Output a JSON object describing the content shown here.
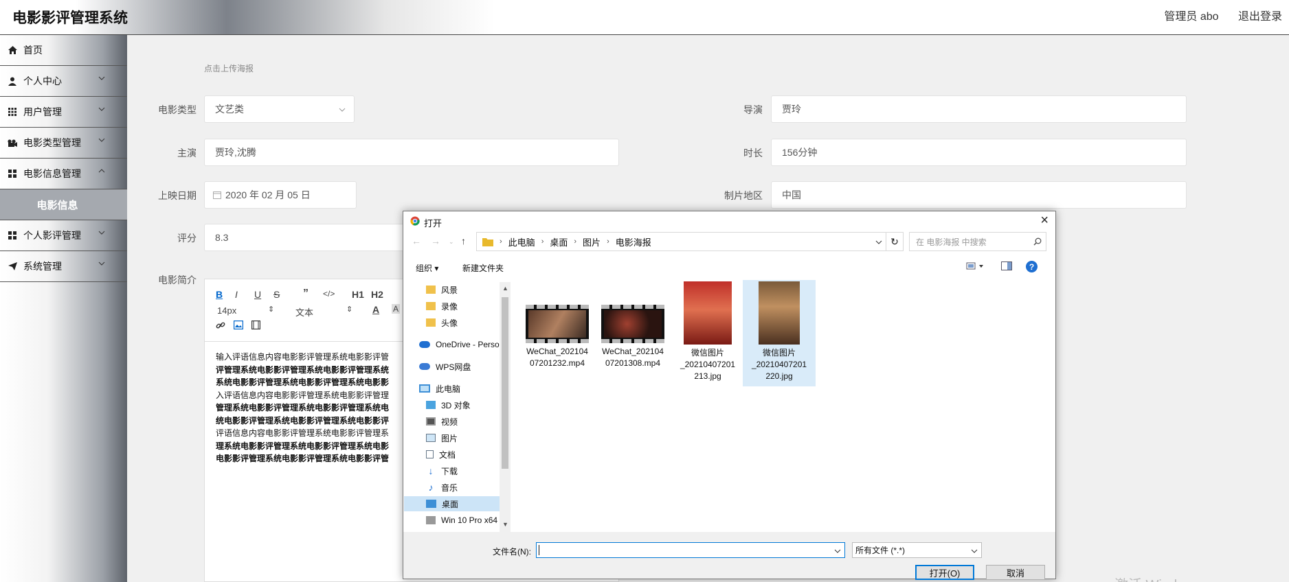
{
  "app": {
    "title": "电影影评管理系统"
  },
  "header": {
    "user": "管理员 abo",
    "logout": "退出登录"
  },
  "sidebar": {
    "items": [
      {
        "label": "首页",
        "icon": "home-icon"
      },
      {
        "label": "个人中心",
        "icon": "user-icon"
      },
      {
        "label": "用户管理",
        "icon": "grid-icon"
      },
      {
        "label": "电影类型管理",
        "icon": "camera-icon"
      },
      {
        "label": "电影信息管理",
        "icon": "grid-icon"
      },
      {
        "label": "电影信息",
        "icon": ""
      },
      {
        "label": "个人影评管理",
        "icon": "grid-icon"
      },
      {
        "label": "系统管理",
        "icon": "send-icon"
      }
    ]
  },
  "form": {
    "upload_hint": "点击上传海报",
    "type_label": "电影类型",
    "type_value": "文艺类",
    "director_label": "导演",
    "director_value": "贾玲",
    "cast_label": "主演",
    "cast_value": "贾玲,沈腾",
    "duration_label": "时长",
    "duration_value": "156分钟",
    "date_label": "上映日期",
    "date_value": "2020 年 02 月 05 日",
    "region_label": "制片地区",
    "region_value": "中国",
    "rating_label": "评分",
    "rating_value": "8.3",
    "intro_label": "电影简介"
  },
  "editor": {
    "font_size": "14px",
    "block_type": "文本",
    "h1": "H1",
    "h2": "H2",
    "content_prefix": "输入评语信息内容",
    "content_lines": [
      "输入评语信息内容电影影评管理系统电影影评管",
      "评管理系统电影影评管理系统电影影评管理系统",
      "系统电影影评管理系统电影影评管理系统电影影",
      "入评语信息内容电影影评管理系统电影影评管理",
      "管理系统电影影评管理系统电影影评管理系统电",
      "统电影影评管理系统电影影评管理系统电影影评",
      "评语信息内容电影影评管理系统电影影评管理系",
      "理系统电影影评管理系统电影影评管理系统电影",
      "电影影评管理系统电影影评管理系统电影影评管"
    ]
  },
  "dialog": {
    "title": "打开",
    "breadcrumb": [
      "此电脑",
      "桌面",
      "图片",
      "电影海报"
    ],
    "search_placeholder": "在 电影海报 中搜索",
    "organize": "组织",
    "new_folder": "新建文件夹",
    "tree": [
      {
        "label": "风景",
        "icon": "folder-icon"
      },
      {
        "label": "录像",
        "icon": "folder-icon"
      },
      {
        "label": "头像",
        "icon": "folder-icon"
      },
      {
        "label": "OneDrive - Perso",
        "icon": "cloud-icon"
      },
      {
        "label": "WPS网盘",
        "icon": "cloud-icon"
      },
      {
        "label": "此电脑",
        "icon": "computer-icon"
      },
      {
        "label": "3D 对象",
        "icon": "cube-icon"
      },
      {
        "label": "视频",
        "icon": "video-icon"
      },
      {
        "label": "图片",
        "icon": "picture-icon"
      },
      {
        "label": "文档",
        "icon": "document-icon"
      },
      {
        "label": "下载",
        "icon": "download-icon"
      },
      {
        "label": "音乐",
        "icon": "music-icon"
      },
      {
        "label": "桌面",
        "icon": "desktop-icon"
      },
      {
        "label": "Win 10 Pro x64",
        "icon": "drive-icon"
      }
    ],
    "files": [
      {
        "name1": "WeChat_202104",
        "name2": "07201232.mp4",
        "name3": "",
        "kind": "video"
      },
      {
        "name1": "WeChat_202104",
        "name2": "07201308.mp4",
        "name3": "",
        "kind": "video"
      },
      {
        "name1": "微信图片",
        "name2": "_20210407201",
        "name3": "213.jpg",
        "kind": "image"
      },
      {
        "name1": "微信图片",
        "name2": "_20210407201",
        "name3": "220.jpg",
        "kind": "image"
      }
    ],
    "filename_label": "文件名(N):",
    "filename_value": "",
    "filetype": "所有文件 (*.*)",
    "open_button": "打开(O)",
    "cancel_button": "取消"
  },
  "watermark": "激活 Windows"
}
